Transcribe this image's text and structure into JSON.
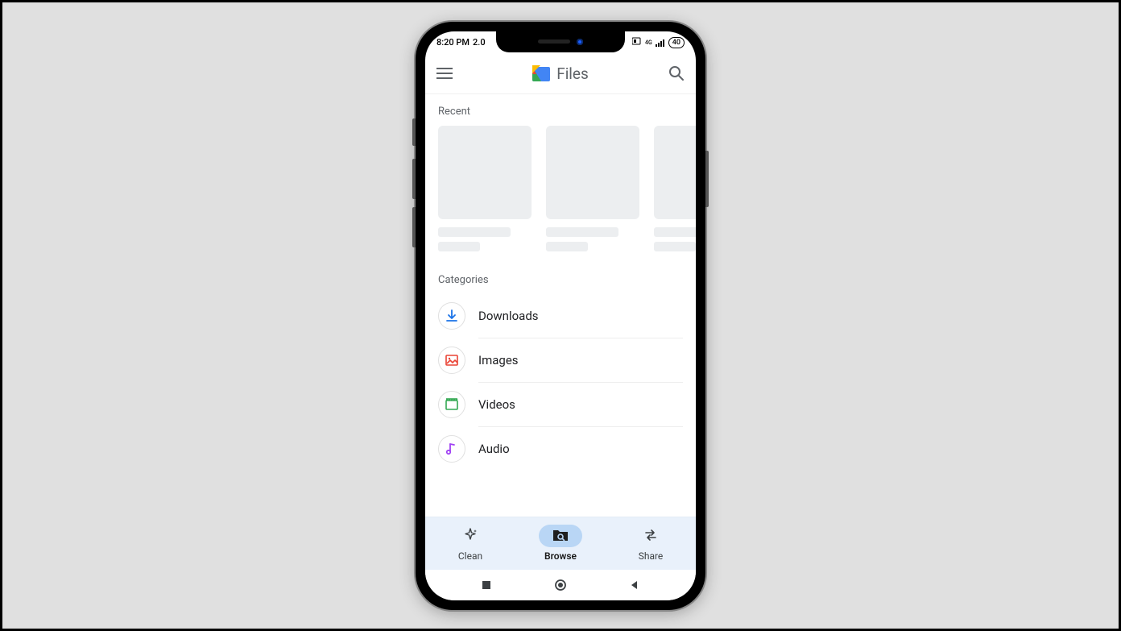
{
  "status": {
    "time": "8:20 PM",
    "extra": "2.0",
    "battery": "40",
    "network_label": "4G"
  },
  "header": {
    "title": "Files"
  },
  "sections": {
    "recent_label": "Recent",
    "categories_label": "Categories"
  },
  "categories": [
    {
      "id": "downloads",
      "label": "Downloads",
      "color": "#1a73e8"
    },
    {
      "id": "images",
      "label": "Images",
      "color": "#ea4335"
    },
    {
      "id": "videos",
      "label": "Videos",
      "color": "#34a853"
    },
    {
      "id": "audio",
      "label": "Audio",
      "color": "#a142f4"
    }
  ],
  "bottom_nav": {
    "clean": "Clean",
    "browse": "Browse",
    "share": "Share",
    "active": "browse"
  }
}
